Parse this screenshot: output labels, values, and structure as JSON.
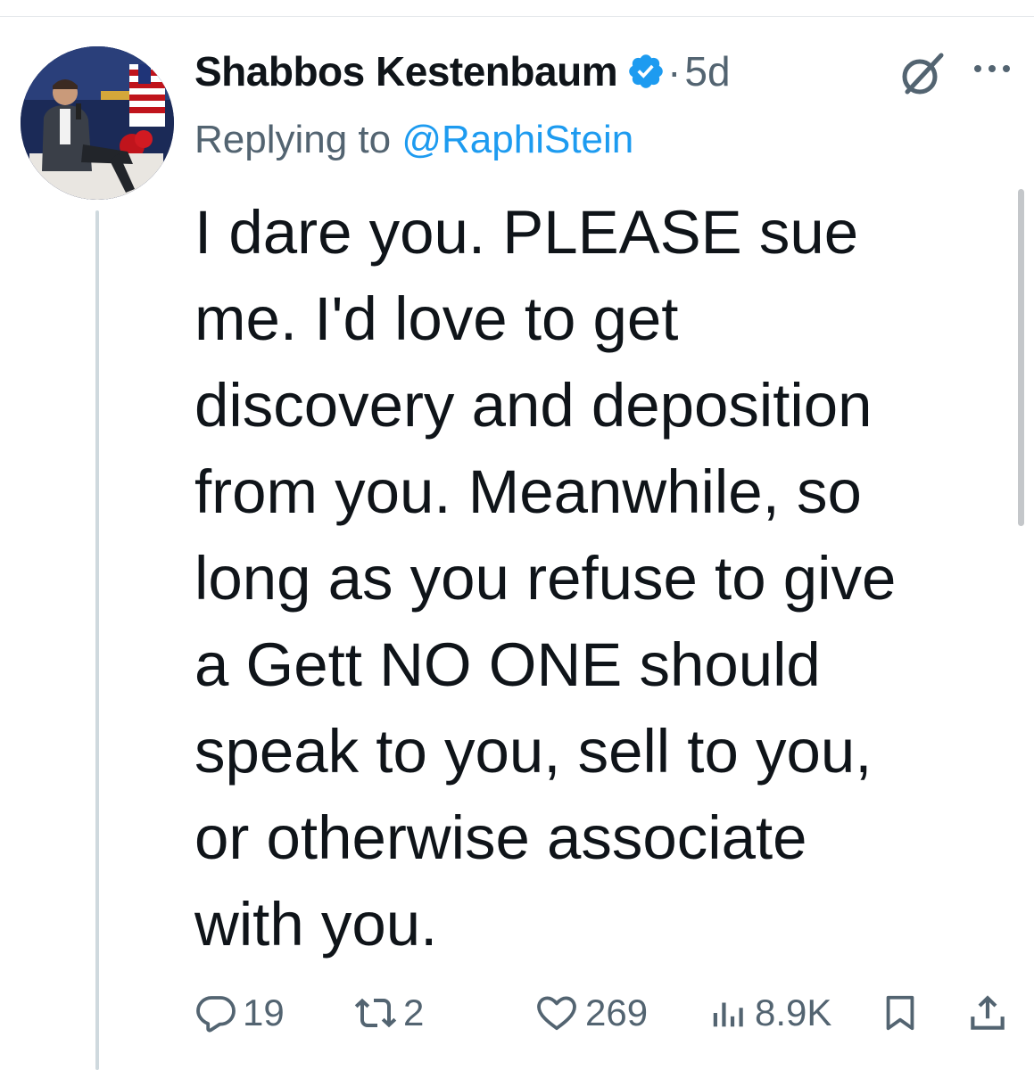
{
  "tweet": {
    "author": {
      "display_name": "Shabbos Kestenbaum",
      "verified_icon": "verified-badge-icon",
      "avatar_colors": {
        "background": "#1b2a57",
        "accent": "#c0141c"
      }
    },
    "timestamp_sep": "·",
    "timestamp": "5d",
    "replying_to_prefix": "Replying to ",
    "replying_to_handle": "@RaphiStein",
    "text_lines": [
      "I dare you. PLEASE sue",
      "me. I'd love to get",
      "discovery and deposition",
      "from you. Meanwhile, so",
      "long as you refuse to give",
      "a Gett NO ONE should",
      "speak to you, sell to you,",
      "or otherwise associate",
      "with you."
    ],
    "actions": {
      "replies": "19",
      "reposts": "2",
      "likes": "269",
      "views": "8.9K"
    }
  },
  "icons": {
    "grok": "grok-icon",
    "more": "more-icon",
    "reply": "reply-icon",
    "repost": "repost-icon",
    "like": "like-icon",
    "views": "views-icon",
    "bookmark": "bookmark-icon",
    "share": "share-icon"
  },
  "colors": {
    "text": "#0f1419",
    "secondary": "#536471",
    "link": "#1d9bf0",
    "verified": "#1d9bf0",
    "thread_line": "#cfd9de"
  }
}
